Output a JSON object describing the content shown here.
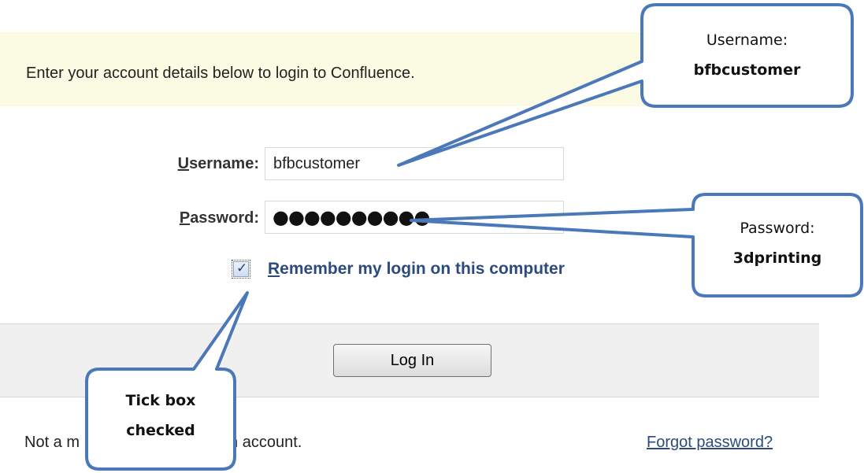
{
  "banner": {
    "text": "Enter your account details below to login to Confluence."
  },
  "form": {
    "username_label_first": "U",
    "username_label_rest": "sername:",
    "username_value": "bfbcustomer",
    "password_label_first": "P",
    "password_label_rest": "assword:",
    "password_masked": "●●●●●●●●●●",
    "remember_checked": true,
    "remember_label_first": "R",
    "remember_label_rest": "emember my login on this computer",
    "login_button": "Log In"
  },
  "footer": {
    "signup_text_visible_start": "Not a m",
    "signup_text_visible_end": "for an account.",
    "forgot_link": "Forgot password?"
  },
  "callouts": {
    "username": {
      "line1": "Username:",
      "line2": "bfbcustomer"
    },
    "password": {
      "line1": "Password:",
      "line2": "3dprinting"
    },
    "tickbox": {
      "line1": "Tick box",
      "line2": "checked"
    }
  },
  "colors": {
    "callout_border": "#4a78b8",
    "link": "#2c4a7c",
    "banner_bg": "#fbfbe3"
  },
  "icons": {
    "checkbox": "checkmark-icon"
  }
}
